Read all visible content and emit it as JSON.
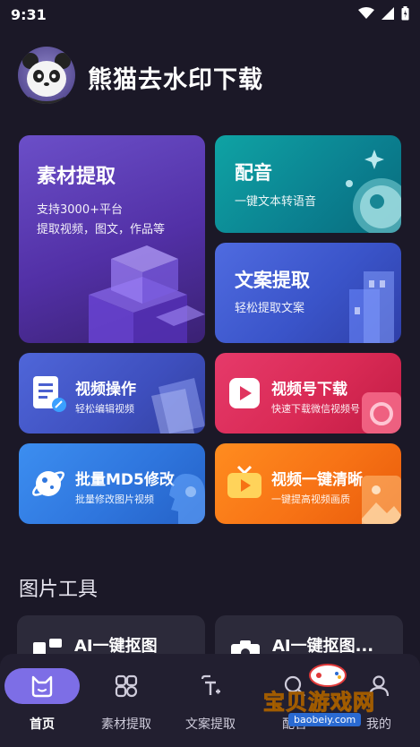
{
  "status_bar": {
    "time": "9:31"
  },
  "header": {
    "app_title": "熊猫去水印下载"
  },
  "cards": {
    "material": {
      "title": "素材提取",
      "line1": "支持3000+平台",
      "line2": "提取视频，图文，作品等"
    },
    "dub": {
      "title": "配音",
      "subtitle": "一键文本转语音"
    },
    "copy": {
      "title": "文案提取",
      "subtitle": "轻松提取文案"
    },
    "video_op": {
      "title": "视频操作",
      "subtitle": "轻松编辑视频"
    },
    "wechat": {
      "title": "视频号下载",
      "subtitle": "快速下载微信视频号"
    },
    "md5": {
      "title": "批量MD5修改",
      "subtitle": "批量修改图片视频"
    },
    "hd": {
      "title": "视频一键清晰",
      "subtitle": "一键提高视频画质"
    }
  },
  "image_tools": {
    "section_title": "图片工具",
    "items": [
      {
        "label": "AI一键抠图"
      },
      {
        "label": "AI一键抠图..."
      }
    ]
  },
  "bottom_nav": {
    "items": [
      {
        "label": "首页",
        "icon": "home-cat-icon",
        "active": true
      },
      {
        "label": "素材提取",
        "icon": "material-icon"
      },
      {
        "label": "文案提取",
        "icon": "text-extract-icon"
      },
      {
        "label": "配音",
        "icon": "dub-icon"
      },
      {
        "label": "我的",
        "icon": "profile-icon"
      }
    ]
  },
  "watermark": {
    "text": "宝贝游戏网",
    "url": "baobeiy.com"
  },
  "colors": {
    "background": "#1b1827",
    "accent": "#7d6ee6"
  }
}
